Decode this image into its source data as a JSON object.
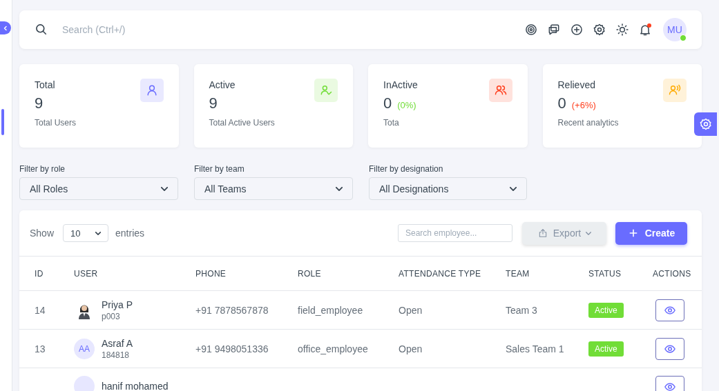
{
  "header": {
    "search": {
      "placeholder": "Search (Ctrl+/)"
    },
    "notifications": {
      "unread": true
    },
    "avatar": {
      "initials": "MU",
      "online": true
    }
  },
  "stats": [
    {
      "kind": "user",
      "color": "#696cff",
      "title": "Total",
      "value": "9",
      "caption": "Total Users"
    },
    {
      "kind": "user-check",
      "color": "#71dd37",
      "title": "Active",
      "value": "9",
      "caption": "Total Active Users"
    },
    {
      "kind": "users",
      "color": "#ff3e1d",
      "title": "InActive",
      "value": "0",
      "change": "(0%)",
      "positive": true,
      "caption": "Tota"
    },
    {
      "kind": "user-voice",
      "color": "#ffab00",
      "title": "Relieved",
      "value": "0",
      "change": "(+6%)",
      "positive": false,
      "caption": "Recent analytics"
    }
  ],
  "filters": [
    {
      "label": "Filter by role",
      "value": "All Roles"
    },
    {
      "label": "Filter by team",
      "value": "All Teams"
    },
    {
      "label": "Filter by designation",
      "value": "All Designations"
    }
  ],
  "table": {
    "show_label": "Show",
    "page_size": "10",
    "entries_label": "entries",
    "search": {
      "placeholder": "Search employee..."
    },
    "export_label": "Export",
    "create_label": "Create",
    "columns": [
      "ID",
      "USER",
      "PHONE",
      "ROLE",
      "ATTENDANCE TYPE",
      "TEAM",
      "STATUS",
      "ACTIONS"
    ],
    "rows": [
      {
        "id": "14",
        "user": {
          "name": "Priya P",
          "code": "p003",
          "avatar": {
            "kind": "figure"
          }
        },
        "phone": "+91 7878567878",
        "role": "field_employee",
        "attendance_type": "Open",
        "team": "Team 3",
        "status": "Active"
      },
      {
        "id": "13",
        "user": {
          "name": "Asraf A",
          "code": "184818",
          "avatar": {
            "kind": "initials",
            "initials": "AA"
          }
        },
        "phone": "+91 9498051336",
        "role": "office_employee",
        "attendance_type": "Open",
        "team": "Sales Team 1",
        "status": "Active"
      },
      {
        "user": {
          "name": "hanif mohamed",
          "avatar": {
            "kind": "initials"
          }
        }
      }
    ]
  }
}
